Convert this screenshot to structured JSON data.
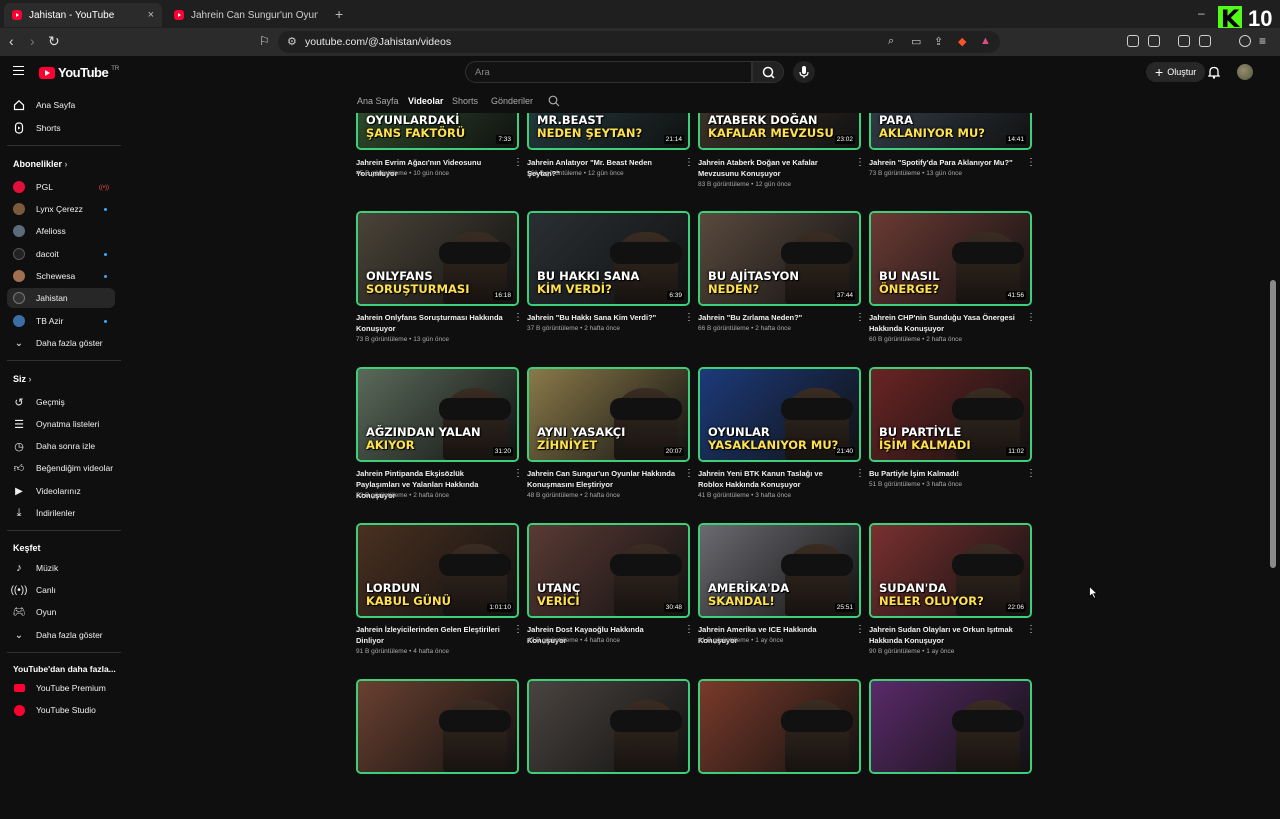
{
  "browser": {
    "tabs": [
      {
        "title": "Jahistan - YouTube",
        "close": "×"
      },
      {
        "title": "Jahrein Can Sungur'un Oyunlar Hakkı",
        "close": ""
      }
    ],
    "new_tab": "+",
    "url": "youtube.com/@Jahistan/videos",
    "window_controls": [
      "–",
      "□",
      "×"
    ]
  },
  "overlay": {
    "k_logo": "K",
    "number": "10"
  },
  "header": {
    "logo": "YouTube",
    "logo_region": "TR",
    "search_placeholder": "Ara",
    "create_label": "Oluştur"
  },
  "sidebar": {
    "top": [
      {
        "label": "Ana Sayfa",
        "icon": "home-icon"
      },
      {
        "label": "Shorts",
        "icon": "shorts-icon"
      }
    ],
    "subscriptions_title": "Abonelikler",
    "subscriptions": [
      {
        "label": "PGL",
        "color": "#e0103a",
        "badge": "live"
      },
      {
        "label": "Lynx Çerezz",
        "color": "#7a5a3a",
        "badge": "dot"
      },
      {
        "label": "Afelioss",
        "color": "#5b6b7a",
        "badge": ""
      },
      {
        "label": "dacoit",
        "color": "#222222",
        "badge": "dot"
      },
      {
        "label": "Schewesa",
        "color": "#a07050",
        "badge": "dot"
      },
      {
        "label": "Jahistan",
        "color": "#333333",
        "badge": "",
        "active": true
      },
      {
        "label": "TB Azir",
        "color": "#3a6ea5",
        "badge": "dot"
      }
    ],
    "show_more": "Daha fazla göster",
    "you_title": "Siz",
    "you_items": [
      {
        "label": "Geçmiş",
        "icon": "history-icon"
      },
      {
        "label": "Oynatma listeleri",
        "icon": "playlist-icon"
      },
      {
        "label": "Daha sonra izle",
        "icon": "clock-icon"
      },
      {
        "label": "Beğendiğim videolar",
        "icon": "like-icon"
      },
      {
        "label": "Videolarınız",
        "icon": "your-videos-icon"
      },
      {
        "label": "İndirilenler",
        "icon": "download-icon"
      }
    ],
    "explore_title": "Keşfet",
    "explore_items": [
      {
        "label": "Müzik",
        "icon": "music-icon"
      },
      {
        "label": "Canlı",
        "icon": "live-icon"
      },
      {
        "label": "Oyun",
        "icon": "gaming-icon"
      }
    ],
    "explore_more": "Daha fazla göster",
    "more_title": "YouTube'dan daha fazla...",
    "more_items": [
      {
        "label": "YouTube Premium",
        "icon": "youtube-premium-icon"
      },
      {
        "label": "YouTube Studio",
        "icon": "youtube-studio-icon"
      }
    ]
  },
  "channel_tabs": [
    "Ana Sayfa",
    "Videolar",
    "Shorts",
    "Gönderiler"
  ],
  "active_tab": "Videolar",
  "videos": [
    {
      "thumb_text": [
        "OYUNLARDAKİ",
        "ŞANS FAKTÖRÜ"
      ],
      "duration": "7:33",
      "title": "Jahrein Evrim Ağacı'nın Videosunu Yorumluyor",
      "meta": "45 B görüntüleme • 10 gün önce",
      "bg": "#2d4a2a"
    },
    {
      "thumb_text": [
        "MR.BEAST",
        "NEDEN ŞEYTAN?"
      ],
      "duration": "21:14",
      "title": "Jahrein Anlatıyor \"Mr. Beast Neden Şeytan?\"",
      "meta": "161 B görüntüleme • 12 gün önce",
      "bg": "#22383a"
    },
    {
      "thumb_text": [
        "ATABERK DOĞAN",
        "KAFALAR MEVZUSU"
      ],
      "duration": "23:02",
      "title": "Jahrein Ataberk Doğan ve Kafalar Mevzusunu Konuşuyor",
      "meta": "83 B görüntüleme • 12 gün önce",
      "bg": "#3a3028"
    },
    {
      "thumb_text": [
        "PARA",
        "AKLANIYOR MU?"
      ],
      "duration": "14:41",
      "title": "Jahrein \"Spotify'da Para Aklanıyor Mu?\"",
      "meta": "73 B görüntüleme • 13 gün önce",
      "bg": "#303a44"
    },
    {
      "thumb_text": [
        "ONLYFANS",
        "SORUŞTURMASI"
      ],
      "duration": "16:18",
      "title": "Jahrein Onlyfans Soruşturması Hakkında Konuşuyor",
      "meta": "73 B görüntüleme • 13 gün önce",
      "bg": "#4a4438"
    },
    {
      "thumb_text": [
        "BU HAKKI SANA",
        "KİM VERDİ?"
      ],
      "duration": "6:39",
      "title": "Jahrein \"Bu Hakkı Sana Kim Verdi?\"",
      "meta": "37 B görüntüleme • 2 hafta önce",
      "bg": "#2a2f33"
    },
    {
      "thumb_text": [
        "BU AJİTASYON",
        "NEDEN?"
      ],
      "duration": "37:44",
      "title": "Jahrein \"Bu Zırlama Neden?\"",
      "meta": "66 B görüntüleme • 2 hafta önce",
      "bg": "#5a4a3e"
    },
    {
      "thumb_text": [
        "BU NASIL",
        "ÖNERGE?"
      ],
      "duration": "41:56",
      "title": "Jahrein CHP'nin Sunduğu Yasa Önergesi Hakkında Konuşuyor",
      "meta": "60 B görüntüleme • 2 hafta önce",
      "bg": "#6b3a34"
    },
    {
      "thumb_text": [
        "AĞZINDAN YALAN",
        "AKIYOR"
      ],
      "duration": "31:20",
      "title": "Jahrein Pintipanda Ekşisözlük Paylaşımları ve Yalanları Hakkında Konuşuyor",
      "meta": "53 B görüntüleme • 2 hafta önce",
      "bg": "#5a6a5a"
    },
    {
      "thumb_text": [
        "AYNI YASAKÇI",
        "ZİHNİYET"
      ],
      "duration": "20:07",
      "title": "Jahrein Can Sungur'un Oyunlar Hakkında Konuşmasını Eleştiriyor",
      "meta": "48 B görüntüleme • 2 hafta önce",
      "bg": "#8a7a4a"
    },
    {
      "thumb_text": [
        "OYUNLAR",
        "YASAKLANIYOR MU?"
      ],
      "duration": "21:40",
      "title": "Jahrein Yeni BTK Kanun Taslağı ve Roblox Hakkında Konuşuyor",
      "meta": "41 B görüntüleme • 3 hafta önce",
      "bg": "#1c3a7a"
    },
    {
      "thumb_text": [
        "BU PARTİYLE",
        "İŞİM KALMADI"
      ],
      "duration": "11:02",
      "title": "Bu Partiyle İşim Kalmadı!",
      "meta": "51 B görüntüleme • 3 hafta önce",
      "bg": "#6a2424"
    },
    {
      "thumb_text": [
        "LORDUN",
        "KABUL GÜNÜ"
      ],
      "duration": "1:01:10",
      "title": "Jahrein İzleyicilerinden Gelen Eleştirileri Dinliyor",
      "meta": "91 B görüntüleme • 4 hafta önce",
      "bg": "#4a3020"
    },
    {
      "thumb_text": [
        "UTANÇ",
        "VERİCİ"
      ],
      "duration": "30:48",
      "title": "Jahrein Dost Kayaoğlu Hakkında Konuşuyor",
      "meta": "47 B görüntüleme • 4 hafta önce",
      "bg": "#5a3a34"
    },
    {
      "thumb_text": [
        "AMERİKA'DA",
        "SKANDAL!"
      ],
      "duration": "25:51",
      "title": "Jahrein Amerika ve ICE Hakkında Konuşuyor",
      "meta": "41 B görüntüleme • 1 ay önce",
      "bg": "#6a6a70"
    },
    {
      "thumb_text": [
        "SUDAN'DA",
        "NELER OLUYOR?"
      ],
      "duration": "22:06",
      "title": "Jahrein Sudan Olayları ve Orkun Işıtmak Hakkında Konuşuyor",
      "meta": "90 B görüntüleme • 1 ay önce",
      "bg": "#7a3030"
    },
    {
      "thumb_text": [
        "",
        ""
      ],
      "duration": "",
      "title": "",
      "meta": "",
      "bg": "#6a4030"
    },
    {
      "thumb_text": [
        "",
        ""
      ],
      "duration": "",
      "title": "",
      "meta": "",
      "bg": "#4a4440"
    },
    {
      "thumb_text": [
        "",
        ""
      ],
      "duration": "",
      "title": "",
      "meta": "",
      "bg": "#7a3a2a"
    },
    {
      "thumb_text": [
        "",
        ""
      ],
      "duration": "",
      "title": "",
      "meta": "",
      "bg": "#5a2a6a"
    }
  ]
}
